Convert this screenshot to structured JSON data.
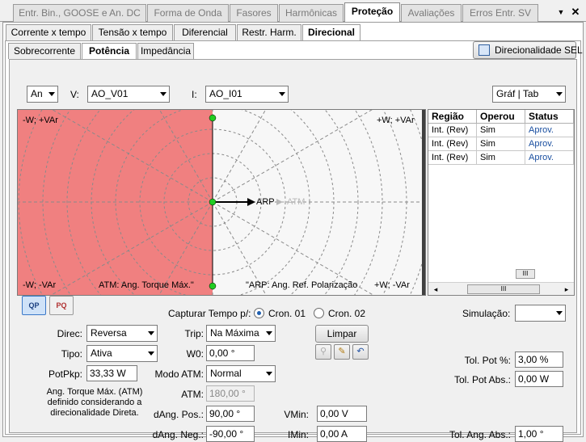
{
  "top_tabs": [
    {
      "label": "Entr. Bin., GOOSE e An. DC",
      "active": false
    },
    {
      "label": "Forma de Onda",
      "active": false
    },
    {
      "label": "Fasores",
      "active": false
    },
    {
      "label": "Harmônicas",
      "active": false
    },
    {
      "label": "Proteção",
      "active": true
    },
    {
      "label": "Avaliações",
      "active": false
    },
    {
      "label": "Erros Entr. SV",
      "active": false
    }
  ],
  "window_controls": {
    "dropdown_glyph": "▼",
    "close_glyph": "✕"
  },
  "protection_tabs": [
    {
      "label": "Corrente x tempo",
      "active": false
    },
    {
      "label": "Tensão x tempo",
      "active": false
    },
    {
      "label": "Diferencial",
      "active": false
    },
    {
      "label": "Restr. Harm.",
      "active": false
    },
    {
      "label": "Direcional",
      "active": true
    }
  ],
  "direcional_tabs": [
    {
      "label": "Sobrecorrente",
      "active": false
    },
    {
      "label": "Potência",
      "active": true
    },
    {
      "label": "Impedância",
      "active": false
    }
  ],
  "sel_button": {
    "label": "Direcionalidade SEL",
    "icon": "sel-document-icon"
  },
  "controls": {
    "an_select": "An",
    "v_label": "V:",
    "v_select": "AO_V01",
    "i_label": "I:",
    "i_select": "AO_I01",
    "view_select": "Gráf | Tab"
  },
  "plot": {
    "quadrant_labels": {
      "top_left": "-W; +VAr",
      "top_right": "+W; +VAr",
      "bottom_left": "-W; -VAr",
      "bottom_right": "+W; -VAr"
    },
    "arrow_label_arp": "ARP",
    "arrow_label_atm": "ATM",
    "legend_atm": "ATM: Ang. Torque Máx.\"",
    "legend_arp": "\"ARP: Ang. Ref. Polarização",
    "colors": {
      "trip_region": "#f08080",
      "plot_bg": "#f7f7f7",
      "marker": "#22cc22",
      "arrow": "#000000",
      "atm_arrow": "#b8b8b8"
    }
  },
  "results_table": {
    "columns": [
      "Região",
      "Operou",
      "Status"
    ],
    "rows": [
      [
        "Int. (Rev)",
        "Sim",
        "Aprov."
      ],
      [
        "Int. (Rev)",
        "Sim",
        "Aprov."
      ],
      [
        "Int. (Rev)",
        "Sim",
        "Aprov."
      ]
    ],
    "scroll_thumb_glyph": "III",
    "scroll_left_glyph": "◂",
    "scroll_right_glyph": "▸"
  },
  "chart_buttons": [
    {
      "icon": "qp-chart-icon",
      "glyph": "QP",
      "pressed": true
    },
    {
      "icon": "pq-chart-icon",
      "glyph": "PQ",
      "pressed": false
    }
  ],
  "capture": {
    "label": "Capturar Tempo p/:",
    "options": [
      {
        "label": "Cron. 01",
        "selected": true
      },
      {
        "label": "Cron. 02",
        "selected": false
      }
    ]
  },
  "simulacao": {
    "label": "Simulação:",
    "value": ""
  },
  "form": {
    "direc_label": "Direc:",
    "direc_value": "Reversa",
    "tipo_label": "Tipo:",
    "tipo_value": "Ativa",
    "potpkp_label": "PotPkp:",
    "potpkp_value": "33,33 W",
    "ang_note": "Ang. Torque Máx. (ATM) definido considerando a direcionalidade Direta.",
    "trip_label": "Trip:",
    "trip_value": "Na Máxima",
    "w0_label": "W0:",
    "w0_value": "0,00 °",
    "modo_atm_label": "Modo ATM:",
    "modo_atm_value": "Normal",
    "atm_label": "ATM:",
    "atm_value": "180,00 °",
    "dang_pos_label": "dAng. Pos.:",
    "dang_pos_value": "90,00 °",
    "dang_neg_label": "dAng. Neg.:",
    "dang_neg_value": "-90,00 °",
    "limpar_label": "Limpar",
    "vmin_label": "VMin:",
    "vmin_value": "0,00 V",
    "imin_label": "IMin:",
    "imin_value": "0,00 A",
    "tol_pot_pct_label": "Tol. Pot %:",
    "tol_pot_pct_value": "3,00 %",
    "tol_pot_abs_label": "Tol. Pot Abs.:",
    "tol_pot_abs_value": "0,00 W",
    "tol_ang_abs_label": "Tol. Ang. Abs.:",
    "tol_ang_abs_value": "1,00 °"
  }
}
